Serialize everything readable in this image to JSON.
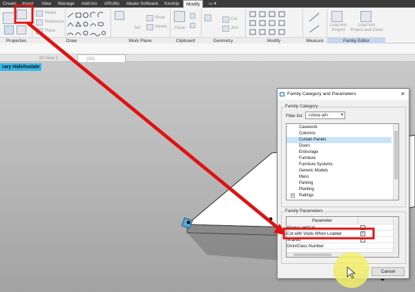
{
  "ribbon_tabs": [
    "Create",
    "Insert",
    "View",
    "Manage",
    "Add-Ins",
    "ARUtils",
    "Ideate Software",
    "Kinship",
    "Modify",
    "▭ ▾"
  ],
  "ribbon_panels": {
    "properties": "Properties",
    "draw": "Draw",
    "work_plane": "Work Plane",
    "clipboard": "Clipboard",
    "geometry": "Geometry",
    "modify": "Modify",
    "measure": "Measure",
    "family_editor": "Family Editor"
  },
  "ribbon_buttons": {
    "model": "Model",
    "reference": "Reference",
    "plane": "Plane",
    "set": "Set",
    "show": "Show",
    "viewer": "Viewer",
    "paste": "Paste",
    "cut": "Cut",
    "join": "Join",
    "load_into_project": "Load into\nProject",
    "load_into_project_close": "Load into\nProject and Close"
  },
  "doc_tabs": [
    "3D View 1",
    "{3D}"
  ],
  "temp_hide": "rary Hide/Isolate",
  "dialog": {
    "title": "Family Category and Parameters",
    "close": "✕",
    "category_group": "Family Category",
    "filter_label": "Filter list:",
    "filter_value": "<show all>",
    "categories": [
      "Casework",
      "Columns",
      "Curtain Panels",
      "Doors",
      "Entourage",
      "Furniture",
      "Furniture Systems",
      "Generic Models",
      "Mass",
      "Parking",
      "Planting",
      "Railings",
      "Sit..."
    ],
    "selected_category": "Curtain Panels",
    "params_group": "Family Parameters",
    "col_parameter": "Parameter",
    "col_value": "Value",
    "params": [
      {
        "name": "Always vertical",
        "checked": false
      },
      {
        "name": "Cut with Voids When Loaded",
        "checked": true
      },
      {
        "name": "Shared",
        "checked": true
      },
      {
        "name": "OmniClass Number",
        "checked": null
      }
    ],
    "ok": "OK",
    "cancel": "Cancel"
  },
  "colors": {
    "highlight": "#e01212",
    "accent": "#36b7e8",
    "family_editor": "#c5d5ee",
    "cursor_glow": "#f2ee6a"
  }
}
